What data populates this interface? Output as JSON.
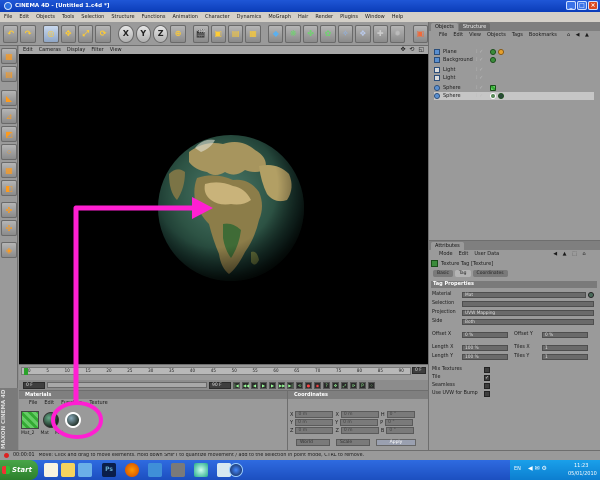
{
  "window": {
    "title": "CINEMA 4D - [Untitled 1.c4d *]",
    "controls": [
      "_",
      "□",
      "×"
    ]
  },
  "menubar": [
    "File",
    "Edit",
    "Objects",
    "Tools",
    "Selection",
    "Structure",
    "Functions",
    "Animation",
    "Character",
    "Dynamics",
    "MoGraph",
    "Hair",
    "Render",
    "Plugins",
    "Window",
    "Help"
  ],
  "toolbar": {
    "axis_x": "X",
    "axis_y": "Y",
    "axis_z": "Z"
  },
  "viewport": {
    "menu": [
      "Edit",
      "Cameras",
      "Display",
      "Filter",
      "View"
    ],
    "nav_icons": "✥ ⟲ ◱"
  },
  "timeline": {
    "ticks": [
      "0",
      "5",
      "10",
      "15",
      "20",
      "25",
      "30",
      "35",
      "40",
      "45",
      "50",
      "55",
      "60",
      "65",
      "70",
      "75",
      "80",
      "85",
      "90"
    ],
    "frame_right": "0 F",
    "start_field": "0 F",
    "end_field": "90 F"
  },
  "materials": {
    "title": "Materials",
    "menu": [
      "File",
      "Edit",
      "Function",
      "Texture"
    ],
    "items": [
      "Mat_2",
      "Mat",
      "Mat"
    ]
  },
  "coordinates": {
    "title": "Coordinates",
    "rows": [
      {
        "a": "X",
        "v1": "0 m",
        "b": "X",
        "v2": "0 m",
        "c": "H",
        "v3": "0 °"
      },
      {
        "a": "Y",
        "v1": "0 m",
        "b": "Y",
        "v2": "0 m",
        "c": "P",
        "v3": "0 °"
      },
      {
        "a": "Z",
        "v1": "0 m",
        "b": "Z",
        "v2": "0 m",
        "c": "B",
        "v3": "0 °"
      }
    ],
    "mode_world": "World",
    "mode_scale": "Scale",
    "apply": "Apply"
  },
  "maxon_label": "MAXON CINEMA 4D",
  "objects": {
    "tabs": [
      "Objects",
      "Structure"
    ],
    "menu": [
      "File",
      "Edit",
      "View",
      "Objects",
      "Tags",
      "Bookmarks"
    ],
    "rows": [
      {
        "name": "Plane"
      },
      {
        "name": "Background"
      },
      {
        "name": "Light"
      },
      {
        "name": "Light"
      },
      {
        "name": "Sphere"
      },
      {
        "name": "Sphere"
      }
    ]
  },
  "attributes": {
    "title": "Attributes",
    "menu": [
      "Mode",
      "Edit",
      "User Data"
    ],
    "tag_title": "Texture Tag [Texture]",
    "subtabs": [
      "Basic",
      "Tag",
      "Coordinates"
    ],
    "section": "Tag Properties",
    "material_label": "Material",
    "material_value": "Mat",
    "selection_label": "Selection",
    "projection_label": "Projection",
    "projection_value": "UVW Mapping",
    "side_label": "Side",
    "side_value": "Both",
    "offset_x_label": "Offset X",
    "offset_x_value": "0 %",
    "offset_y_label": "Offset Y",
    "offset_y_value": "0 %",
    "length_x_label": "Length X",
    "length_x_value": "100 %",
    "tiles_x_label": "Tiles X",
    "tiles_x_value": "1",
    "length_y_label": "Length Y",
    "length_y_value": "100 %",
    "tiles_y_label": "Tiles Y",
    "tiles_y_value": "1",
    "mix_label": "Mix Textures",
    "tile_label": "Tile",
    "seamless_label": "Seamless",
    "uvw_bump_label": "Use UVW for Bump",
    "tile_check": "✓"
  },
  "statusbar": {
    "time": "00:00:01",
    "message": "Move: Click and drag to move elements. Hold down SHIFT to quantize movement / add to the selection in point mode, CTRL to remove."
  },
  "taskbar": {
    "start": "Start",
    "lang": "EN",
    "time": "11:23",
    "date": "05/01/2010"
  },
  "colors": {
    "annotation": "#ff1fd2",
    "titlebar": "#1f56d6",
    "viewport_bg": "#000000"
  }
}
